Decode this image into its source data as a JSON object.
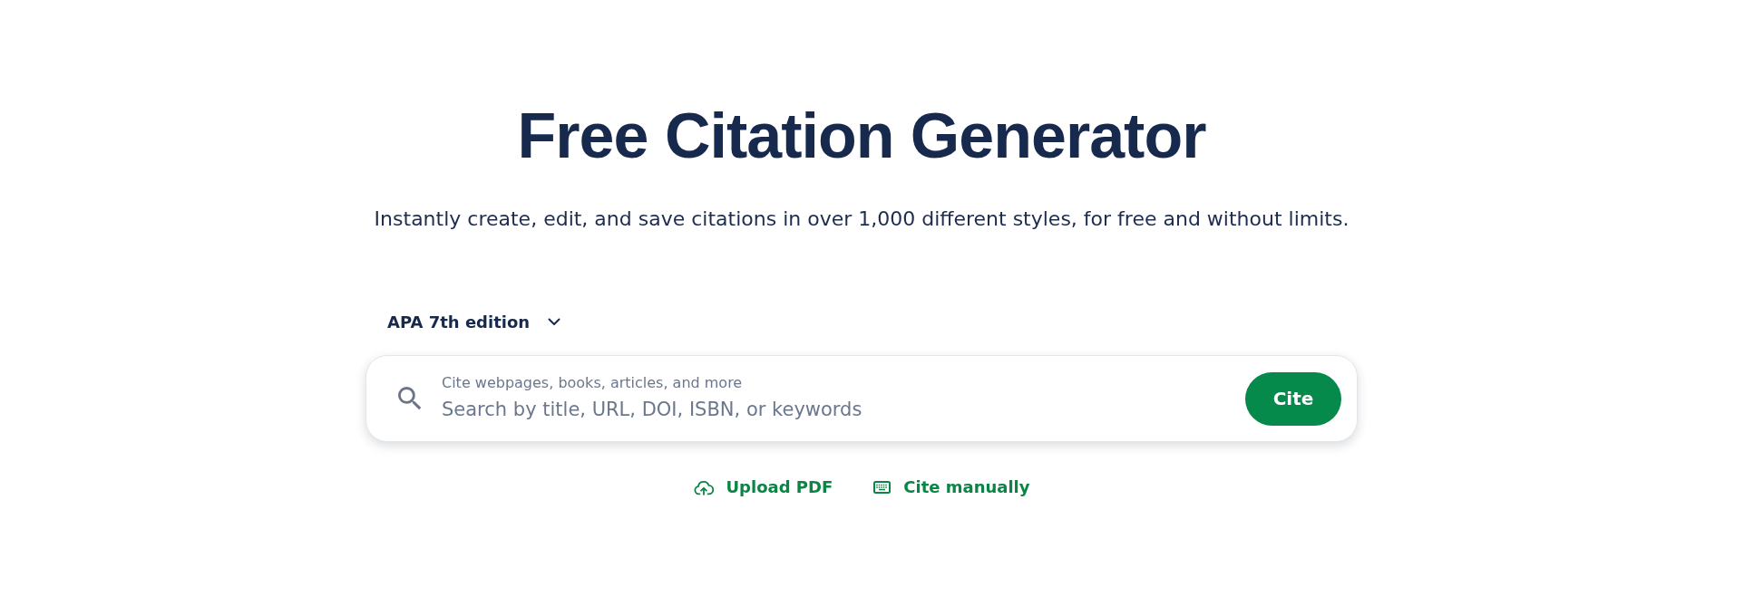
{
  "header": {
    "title": "Free Citation Generator",
    "subtitle": "Instantly create, edit, and save citations in over 1,000 different styles, for free and without limits."
  },
  "style_selector": {
    "value": "APA 7th edition"
  },
  "search": {
    "label": "Cite webpages, books, articles, and more",
    "placeholder": "Search by title, URL, DOI, ISBN, or keywords",
    "button": "Cite"
  },
  "actions": [
    {
      "kind": "upload",
      "label": "Upload PDF"
    },
    {
      "kind": "manual",
      "label": "Cite manually"
    }
  ]
}
